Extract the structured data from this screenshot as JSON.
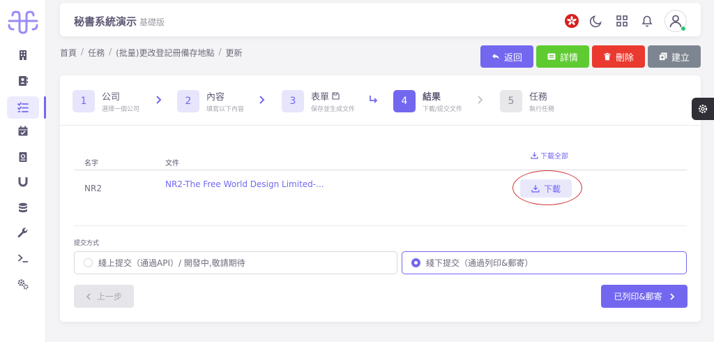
{
  "app": {
    "title": "秘書系統演示",
    "edition": "基礎版"
  },
  "header_icons": [
    "hk-flag-icon",
    "moon-icon",
    "grid-icon",
    "bell-icon",
    "user-icon"
  ],
  "sidebar": {
    "items": [
      {
        "icon": "building-icon"
      },
      {
        "icon": "contact-icon"
      },
      {
        "icon": "task-list-icon",
        "active": true
      },
      {
        "icon": "calendar-check-icon"
      },
      {
        "icon": "book-icon"
      },
      {
        "icon": "magnet-icon"
      },
      {
        "icon": "database-icon"
      },
      {
        "icon": "wrench-icon"
      },
      {
        "icon": "terminal-icon"
      },
      {
        "icon": "settings-icon"
      }
    ]
  },
  "breadcrumb": [
    "首頁",
    "任務",
    "(批量)更改登記冊備存地點",
    "更新"
  ],
  "actions": {
    "back": "返回",
    "details": "詳情",
    "delete": "刪除",
    "create": "建立"
  },
  "colors": {
    "primary": "#7367f0",
    "back": "#7367f0",
    "details": "#5ecb31",
    "delete": "#ea3a30",
    "create": "#7d8690",
    "annotation": "#d0343a"
  },
  "steps": [
    {
      "num": "1",
      "title": "公司",
      "subtitle": "選擇一個公司"
    },
    {
      "num": "2",
      "title": "內容",
      "subtitle": "填寫以下內容"
    },
    {
      "num": "3",
      "title": "表單",
      "subtitle": "保存並生成文件"
    },
    {
      "num": "4",
      "title": "結果",
      "subtitle": "下載/提交文件"
    },
    {
      "num": "5",
      "title": "任務",
      "subtitle": "執行任務"
    }
  ],
  "table": {
    "download_all": "下載全部",
    "col_name": "名字",
    "col_file": "文件",
    "rows": [
      {
        "name": "NR2",
        "file": "NR2-The Free World Design Limited-...",
        "download": "下載"
      }
    ]
  },
  "submit": {
    "label": "提交方式",
    "option_online": "綫上提交（通過API）/ 開發中,敬請期待",
    "option_offline": "綫下提交（通過列印&郵寄）",
    "selected": "offline"
  },
  "nav": {
    "prev": "上一步",
    "next": "已列印&郵寄"
  }
}
